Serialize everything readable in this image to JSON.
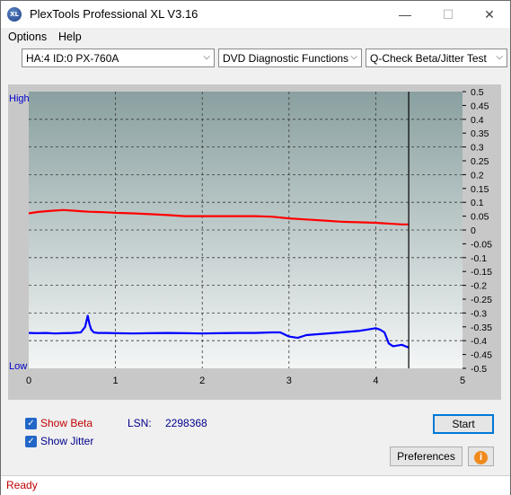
{
  "window": {
    "title": "PlexTools Professional XL V3.16",
    "icon_text": "XL",
    "controls": [
      "minimize-icon",
      "maximize-icon",
      "close-icon"
    ]
  },
  "menu": [
    {
      "label": "Options"
    },
    {
      "label": "Help"
    }
  ],
  "toolbar": {
    "drive": "HA:4 ID:0  PX-760A",
    "function": "DVD Diagnostic Functions",
    "test": "Q-Check Beta/Jitter Test"
  },
  "chart_data": {
    "type": "line",
    "y_label_top": "High",
    "y_label_bottom": "Low",
    "x_ticks": [
      "0",
      "1",
      "2",
      "3",
      "4",
      "5"
    ],
    "xlim": [
      0,
      5
    ],
    "y_ticks": [
      "0.5",
      "0.45",
      "0.4",
      "0.35",
      "0.3",
      "0.25",
      "0.2",
      "0.15",
      "0.1",
      "0.05",
      "0",
      "-0.05",
      "-0.1",
      "-0.15",
      "-0.2",
      "-0.25",
      "-0.3",
      "-0.35",
      "-0.4",
      "-0.45",
      "-0.5"
    ],
    "ylim": [
      -0.5,
      0.5
    ],
    "grid": true,
    "end_marker_x": 4.38,
    "series": [
      {
        "color": "#ff0000",
        "x": [
          0,
          0.1,
          0.2,
          0.3,
          0.4,
          0.5,
          0.6,
          0.7,
          0.8,
          0.9,
          1.0,
          1.2,
          1.4,
          1.6,
          1.8,
          2.0,
          2.2,
          2.4,
          2.6,
          2.8,
          3.0,
          3.2,
          3.4,
          3.6,
          3.8,
          4.0,
          4.1,
          4.2,
          4.3,
          4.38
        ],
        "y": [
          0.06,
          0.065,
          0.068,
          0.07,
          0.072,
          0.07,
          0.068,
          0.066,
          0.065,
          0.064,
          0.062,
          0.06,
          0.057,
          0.054,
          0.05,
          0.05,
          0.05,
          0.05,
          0.05,
          0.048,
          0.042,
          0.038,
          0.034,
          0.03,
          0.028,
          0.026,
          0.024,
          0.022,
          0.02,
          0.02
        ]
      },
      {
        "color": "#0000ff",
        "x": [
          0,
          0.1,
          0.2,
          0.3,
          0.4,
          0.5,
          0.6,
          0.65,
          0.68,
          0.7,
          0.72,
          0.75,
          0.8,
          0.9,
          1.0,
          1.2,
          1.4,
          1.6,
          1.8,
          2.0,
          2.2,
          2.4,
          2.6,
          2.8,
          2.9,
          3.0,
          3.1,
          3.2,
          3.4,
          3.6,
          3.8,
          3.9,
          4.0,
          4.05,
          4.1,
          4.15,
          4.2,
          4.3,
          4.38
        ],
        "y": [
          -0.372,
          -0.373,
          -0.372,
          -0.374,
          -0.373,
          -0.372,
          -0.37,
          -0.35,
          -0.31,
          -0.34,
          -0.36,
          -0.37,
          -0.372,
          -0.372,
          -0.373,
          -0.374,
          -0.373,
          -0.372,
          -0.373,
          -0.374,
          -0.373,
          -0.372,
          -0.372,
          -0.37,
          -0.37,
          -0.385,
          -0.39,
          -0.38,
          -0.375,
          -0.37,
          -0.365,
          -0.36,
          -0.355,
          -0.36,
          -0.37,
          -0.41,
          -0.42,
          -0.415,
          -0.425
        ]
      }
    ]
  },
  "options": {
    "show_beta": "Show Beta",
    "show_jitter": "Show Jitter",
    "lsn_label": "LSN:",
    "lsn_value": "2298368"
  },
  "buttons": {
    "start": "Start",
    "preferences": "Preferences",
    "info": "i"
  },
  "status": "Ready",
  "colors": {
    "accent": "#0078d7",
    "beta": "#ff0000",
    "jitter": "#0000ff",
    "status_text": "#c00000"
  }
}
